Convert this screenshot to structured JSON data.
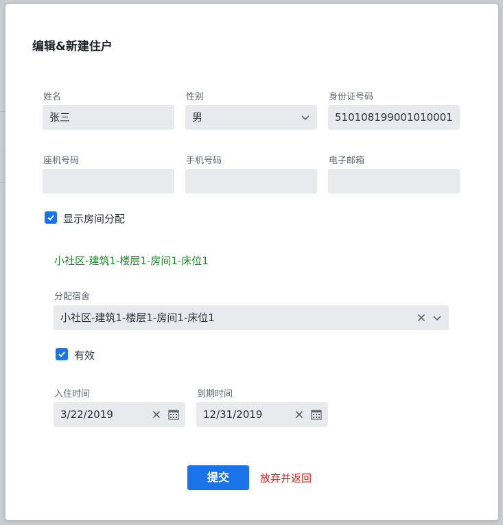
{
  "dialog": {
    "title": "编辑&新建住户"
  },
  "fields": {
    "name": {
      "label": "姓名",
      "value": "张三"
    },
    "gender": {
      "label": "性别",
      "value": "男"
    },
    "id_number": {
      "label": "身份证号码",
      "value": "510108199001010001"
    },
    "landline": {
      "label": "座机号码",
      "value": ""
    },
    "mobile": {
      "label": "手机号码",
      "value": ""
    },
    "email": {
      "label": "电子邮箱",
      "value": ""
    }
  },
  "show_room": {
    "label": "显示房间分配",
    "checked": true
  },
  "room_summary": "小社区-建筑1-楼层1-房间1-床位1",
  "dorm": {
    "label": "分配宿舍",
    "value": "小社区-建筑1-楼层1-房间1-床位1"
  },
  "valid": {
    "label": "有效",
    "checked": true
  },
  "checkin": {
    "label": "入住时间",
    "value": "3/22/2019"
  },
  "expire": {
    "label": "到期时间",
    "value": "12/31/2019"
  },
  "actions": {
    "submit": "提交",
    "discard": "放弃并返回"
  },
  "colors": {
    "accent": "#1a73e8",
    "success": "#1a8a2a",
    "danger": "#e02020"
  }
}
